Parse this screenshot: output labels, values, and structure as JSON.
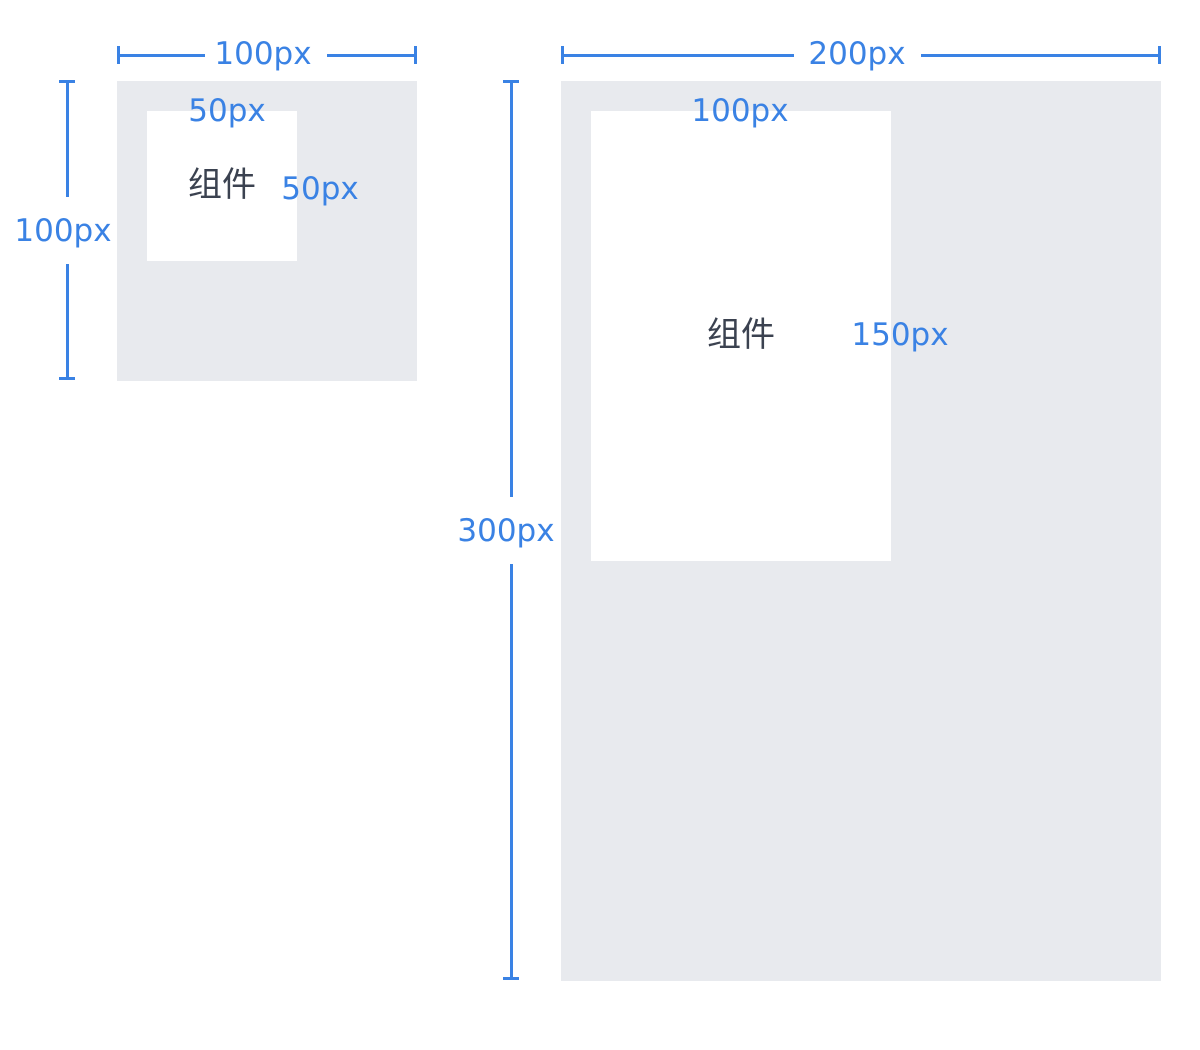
{
  "colors": {
    "accent": "#3a82e4",
    "container": "#e8eaee",
    "component": "#ffffff",
    "text": "#3b4250"
  },
  "left_example": {
    "container_width_label": "100px",
    "container_height_label": "100px",
    "component_width_label": "50px",
    "component_height_label": "50px",
    "component_label": "组件"
  },
  "right_example": {
    "container_width_label": "200px",
    "container_height_label": "300px",
    "component_width_label": "100px",
    "component_height_label": "150px",
    "component_label": "组件"
  }
}
